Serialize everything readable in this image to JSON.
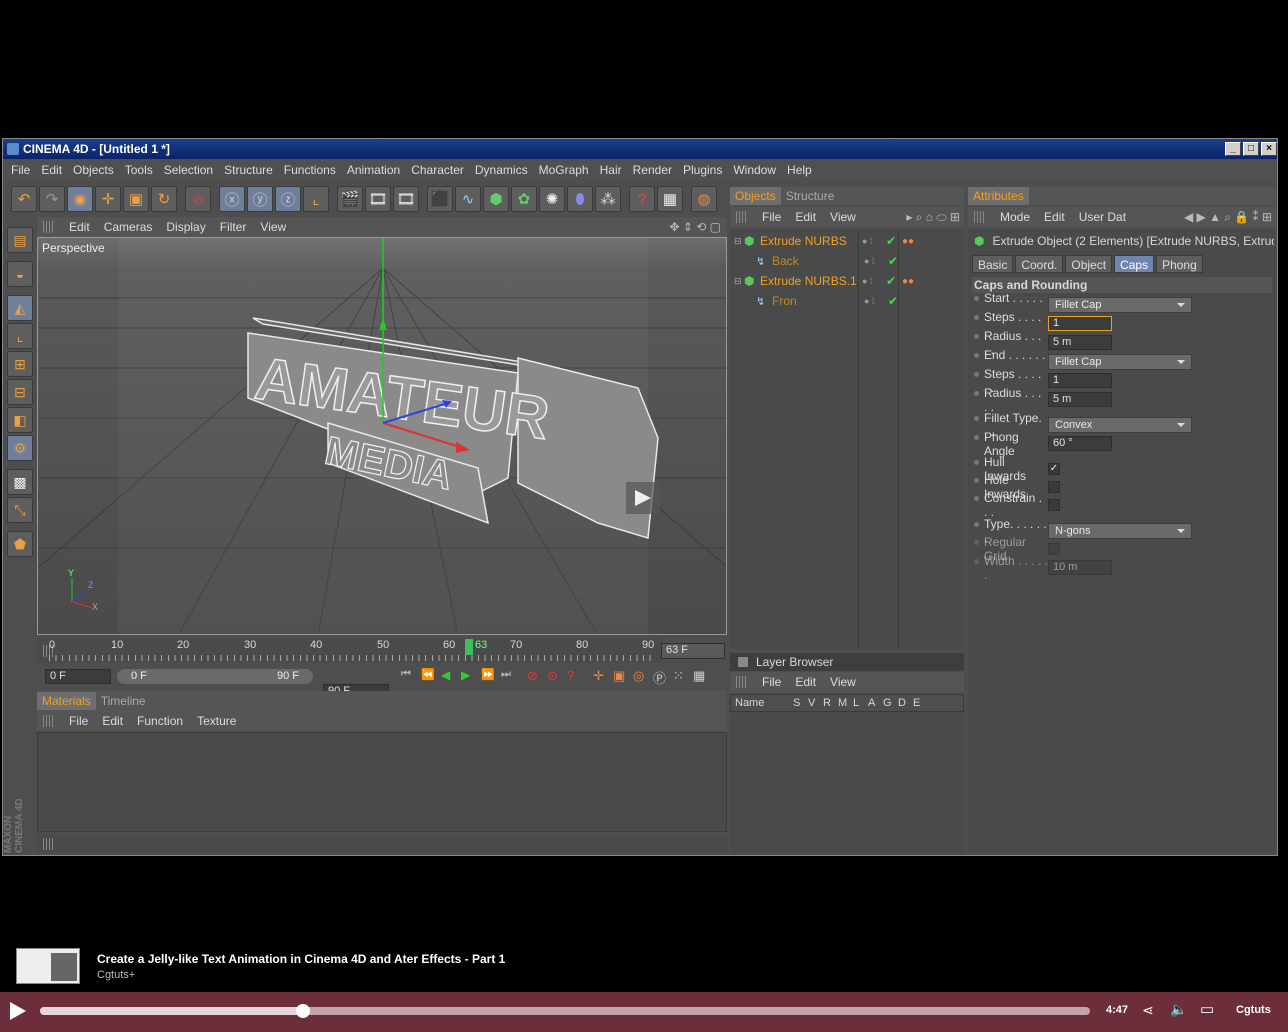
{
  "window": {
    "title": "CINEMA 4D - [Untitled 1 *]"
  },
  "menu": [
    "File",
    "Edit",
    "Objects",
    "Tools",
    "Selection",
    "Structure",
    "Functions",
    "Animation",
    "Character",
    "Dynamics",
    "MoGraph",
    "Hair",
    "Render",
    "Plugins",
    "Window",
    "Help"
  ],
  "viewport": {
    "menu": [
      "Edit",
      "Cameras",
      "Display",
      "Filter",
      "View"
    ],
    "label": "Perspective"
  },
  "timeline": {
    "ticks": [
      "0",
      "10",
      "20",
      "30",
      "40",
      "50",
      "60",
      "63",
      "70",
      "80",
      "90"
    ],
    "current": "63 F",
    "start": "0 F",
    "range_start": "0 F",
    "range_end": "90 F",
    "end": "90 F",
    "position": 0.7
  },
  "materials": {
    "tabs": [
      "Materials",
      "Timeline"
    ],
    "menu": [
      "File",
      "Edit",
      "Function",
      "Texture"
    ],
    "brand": "MAXON CINEMA 4D"
  },
  "objects": {
    "tabs": [
      "Objects",
      "Structure"
    ],
    "menu": [
      "File",
      "Edit",
      "View"
    ],
    "items": [
      {
        "name": "Extrude NURBS",
        "child": false
      },
      {
        "name": "Back",
        "child": true
      },
      {
        "name": "Extrude NURBS.1",
        "child": false
      },
      {
        "name": "Fron",
        "child": true
      }
    ]
  },
  "layers": {
    "title": "Layer Browser",
    "menu": [
      "File",
      "Edit",
      "View"
    ],
    "columns": [
      "Name",
      "S",
      "V",
      "R",
      "M",
      "L",
      "A",
      "G",
      "D",
      "E"
    ]
  },
  "attributes": {
    "tab": "Attributes",
    "menu": [
      "Mode",
      "Edit",
      "User Dat"
    ],
    "object_title": "Extrude Object (2 Elements) [Extrude NURBS, Extrude NUR",
    "subtabs": [
      "Basic",
      "Coord.",
      "Object",
      "Caps",
      "Phong"
    ],
    "active_subtab": "Caps",
    "section": "Caps and Rounding",
    "start": {
      "label": "Start . . . . . .",
      "value": "Fillet Cap"
    },
    "steps1": {
      "label": "Steps . . . . .",
      "value": "1"
    },
    "radius1": {
      "label": "Radius . . . . .",
      "value": "5 m"
    },
    "end": {
      "label": "End . . . . . . .",
      "value": "Fillet Cap"
    },
    "steps2": {
      "label": "Steps . . . . . .",
      "value": "1"
    },
    "radius2": {
      "label": "Radius . . . . .",
      "value": "5 m"
    },
    "fillet_type": {
      "label": "Fillet Type. . .",
      "value": "Convex"
    },
    "phong_angle": {
      "label": "Phong Angle",
      "value": "60 °"
    },
    "hull_inwards": {
      "label": "Hull Inwards",
      "checked": true
    },
    "hole_inwards": {
      "label": "Hole Inwards",
      "checked": false
    },
    "constrain": {
      "label": "Constrain . . .",
      "checked": false
    },
    "type": {
      "label": "Type. . . . . . .",
      "value": "N-gons"
    },
    "regular_grid": {
      "label": "Regular Grid",
      "checked": false
    },
    "width": {
      "label": "Width . . . . . .",
      "value": "10 m"
    }
  },
  "video": {
    "title": "Create a Jelly-like Text Animation in Cinema 4D and Ater Effects - Part 1",
    "channel": "Cgtuts+",
    "time": "4:47",
    "brand": "Cgtuts",
    "progress": 0.25,
    "bar_color": "#6b2e3a"
  }
}
